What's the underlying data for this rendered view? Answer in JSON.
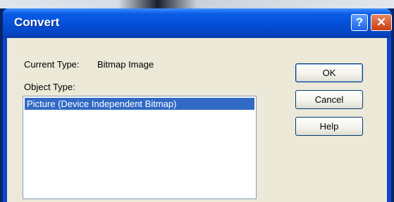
{
  "window": {
    "title": "Convert",
    "help_glyph": "?",
    "close_glyph": "✕"
  },
  "dialog": {
    "current_type_label": "Current Type:",
    "current_type_value": "Bitmap Image",
    "object_type_label": "Object Type:",
    "object_types": [
      "Picture (Device Independent Bitmap)"
    ],
    "selected_object_type": "Picture (Device Independent Bitmap)"
  },
  "buttons": {
    "ok": "OK",
    "cancel": "Cancel",
    "help": "Help"
  },
  "colors": {
    "titlebar": "#0553da",
    "client_bg": "#ece9d8",
    "selection": "#316ac5",
    "close_button": "#c83d14"
  }
}
